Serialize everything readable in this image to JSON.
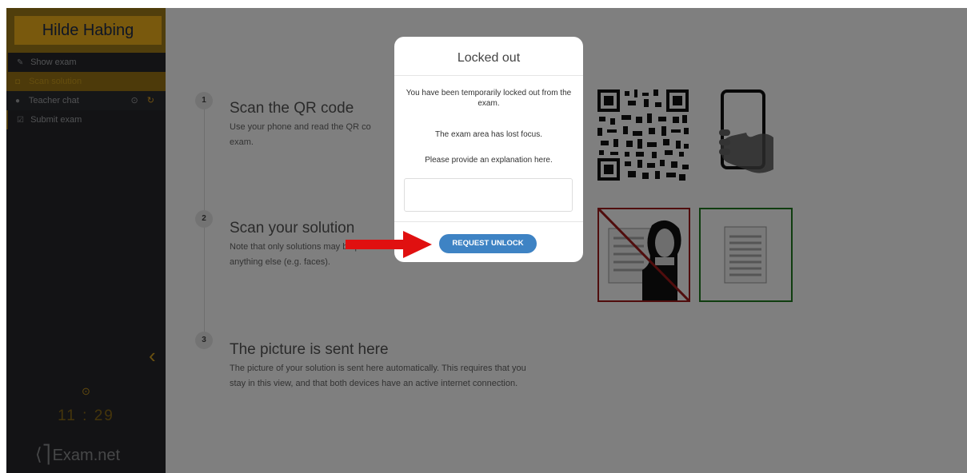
{
  "sidebar": {
    "user_name": "Hilde Habing",
    "items": [
      {
        "label": "Show exam",
        "icon": "edit-icon"
      },
      {
        "label": "Scan solution",
        "icon": "camera-icon"
      },
      {
        "label": "Teacher chat",
        "icon": "chat-icon"
      },
      {
        "label": "Submit exam",
        "icon": "check-square-icon"
      }
    ],
    "timer": "11 : 29",
    "logo_text": "Exam.net"
  },
  "steps": [
    {
      "number": "1",
      "title": "Scan the QR code",
      "desc_visible": "Use your phone and read the QR co",
      "desc_line2": "exam."
    },
    {
      "number": "2",
      "title": "Scan your solution",
      "desc_line1": "Note that only solutions may be pi",
      "desc_line2": "anything else (e.g. faces)."
    },
    {
      "number": "3",
      "title": "The picture is sent here",
      "desc_line1": "The picture of your solution is sent here automatically. This requires that you",
      "desc_line2": "stay in this view, and that both devices have an active internet connection."
    }
  ],
  "modal": {
    "title": "Locked out",
    "msg1": "You have been temporarily locked out from the exam.",
    "msg2": "The exam area has lost focus.",
    "msg3": "Please provide an explanation here.",
    "input_value": "",
    "button_label": "REQUEST UNLOCK"
  },
  "colors": {
    "brand": "#f2b31b",
    "sidebar": "#26272b",
    "button": "#3e83c4",
    "arrow": "#e01010"
  }
}
